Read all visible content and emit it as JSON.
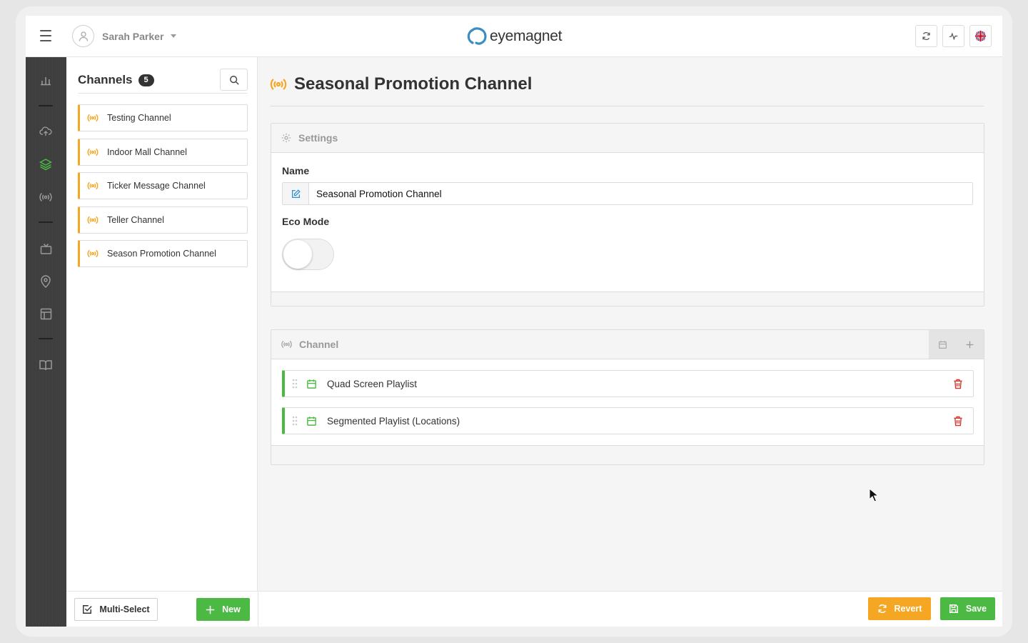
{
  "header": {
    "user_name": "Sarah Parker",
    "logo_text": "eyemagnet",
    "buttons": [
      "refresh-icon",
      "activity-icon",
      "uk-flag-icon"
    ]
  },
  "sidebar_nav": {
    "items": [
      "bar-chart-icon",
      "cloud-upload-icon",
      "layers-icon",
      "broadcast-icon",
      "tv-icon",
      "map-pin-icon",
      "layout-icon",
      "book-icon"
    ],
    "active": "layers-icon"
  },
  "channels_panel": {
    "title": "Channels",
    "count": "5",
    "items": [
      {
        "label": "Testing Channel"
      },
      {
        "label": "Indoor Mall Channel"
      },
      {
        "label": "Ticker Message Channel"
      },
      {
        "label": "Teller Channel"
      },
      {
        "label": "Season Promotion Channel"
      }
    ]
  },
  "main": {
    "title": "Seasonal Promotion Channel",
    "settings": {
      "header": "Settings",
      "name_label": "Name",
      "name_value": "Seasonal Promotion Channel",
      "eco_label": "Eco Mode",
      "eco_on": false
    },
    "channel": {
      "header": "Channel",
      "playlists": [
        {
          "label": "Quad Screen Playlist"
        },
        {
          "label": "Segmented Playlist (Locations)"
        }
      ]
    }
  },
  "footer": {
    "multi_select": "Multi-Select",
    "new": "New",
    "revert": "Revert",
    "save": "Save"
  },
  "colors": {
    "accent_orange": "#f5a623",
    "accent_green": "#4cb944",
    "danger_red": "#d9342b",
    "nav_dark": "#3f3f3f"
  }
}
